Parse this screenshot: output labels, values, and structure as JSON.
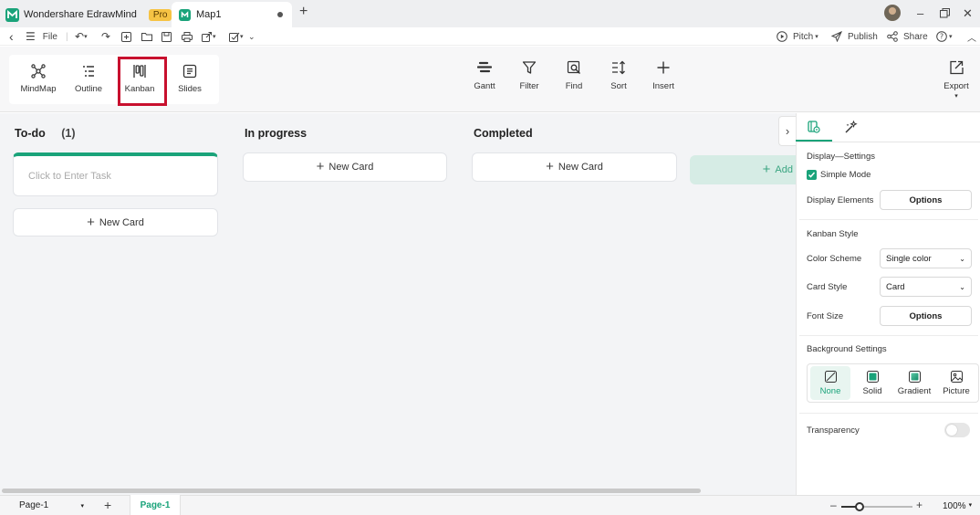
{
  "app": {
    "name": "Wondershare EdrawMind",
    "badge": "Pro"
  },
  "tab": {
    "title": "Map1"
  },
  "menu": {
    "file": "File"
  },
  "top_actions": {
    "pitch": "Pitch",
    "publish": "Publish",
    "share": "Share"
  },
  "views": [
    {
      "label": "MindMap",
      "icon": "mindmap-icon"
    },
    {
      "label": "Outline",
      "icon": "outline-icon"
    },
    {
      "label": "Kanban",
      "icon": "kanban-icon"
    },
    {
      "label": "Slides",
      "icon": "slides-icon"
    }
  ],
  "tools": {
    "gantt": "Gantt",
    "filter": "Filter",
    "find": "Find",
    "sort": "Sort",
    "insert": "Insert",
    "export": "Export"
  },
  "board": {
    "todo_title": "To-do",
    "todo_count": "(1)",
    "task_placeholder": "Click to Enter Task",
    "inprogress_title": "In progress",
    "completed_title": "Completed",
    "new_card": "New Card",
    "add_label": "Add"
  },
  "panel": {
    "display_settings": "Display—Settings",
    "simple_mode": "Simple Mode",
    "display_elements": "Display Elements",
    "options": "Options",
    "kanban_style": "Kanban Style",
    "color_scheme_label": "Color Scheme",
    "color_scheme_value": "Single color",
    "card_style_label": "Card Style",
    "card_style_value": "Card",
    "font_size_label": "Font Size",
    "background_settings": "Background Settings",
    "bg_none": "None",
    "bg_solid": "Solid",
    "bg_gradient": "Gradient",
    "bg_picture": "Picture",
    "transparency": "Transparency"
  },
  "status": {
    "page_select": "Page-1",
    "page_tab": "Page-1",
    "zoom": "100%"
  },
  "colors": {
    "accent": "#1aa37a",
    "highlight": "#c8102e"
  }
}
